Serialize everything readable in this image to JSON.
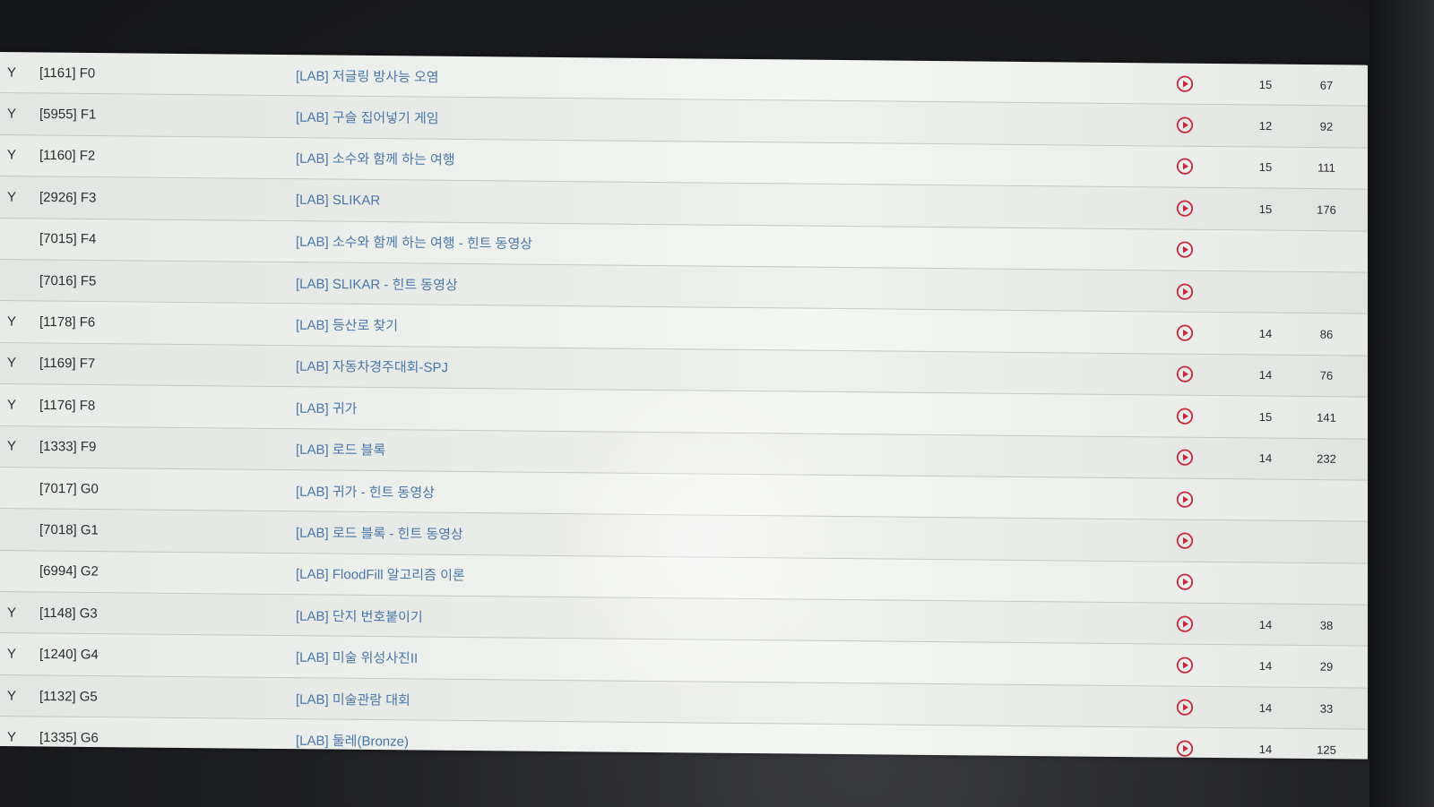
{
  "colors": {
    "link": "#4a76a8",
    "play_icon": "#c8283a",
    "text": "#2a2c2e",
    "background": "#eef0ed"
  },
  "rows": [
    {
      "flag": "Y",
      "code": "[1161] F0",
      "title": "[LAB] 저글링 방사능 오염",
      "n1": "15",
      "n2": "67",
      "icon": "play-circle-icon"
    },
    {
      "flag": "Y",
      "code": "[5955] F1",
      "title": "[LAB] 구슬 집어넣기 게임",
      "n1": "12",
      "n2": "92",
      "icon": "play-circle-icon"
    },
    {
      "flag": "Y",
      "code": "[1160] F2",
      "title": "[LAB] 소수와 함께 하는 여행",
      "n1": "15",
      "n2": "111",
      "icon": "play-circle-icon"
    },
    {
      "flag": "Y",
      "code": "[2926] F3",
      "title": "[LAB] SLIKAR",
      "n1": "15",
      "n2": "176",
      "icon": "play-circle-icon"
    },
    {
      "flag": "",
      "code": "[7015] F4",
      "title": "[LAB] 소수와 함께 하는 여행 - 힌트 동영상",
      "n1": "",
      "n2": "",
      "icon": "play-circle-icon"
    },
    {
      "flag": "",
      "code": "[7016] F5",
      "title": "[LAB] SLIKAR - 힌트 동영상",
      "n1": "",
      "n2": "",
      "icon": "play-circle-icon"
    },
    {
      "flag": "Y",
      "code": "[1178] F6",
      "title": "[LAB] 등산로 찾기",
      "n1": "14",
      "n2": "86",
      "icon": "play-circle-icon"
    },
    {
      "flag": "Y",
      "code": "[1169] F7",
      "title": "[LAB] 자동차경주대회-SPJ",
      "n1": "14",
      "n2": "76",
      "icon": "play-circle-icon"
    },
    {
      "flag": "Y",
      "code": "[1176] F8",
      "title": "[LAB] 귀가",
      "n1": "15",
      "n2": "141",
      "icon": "play-circle-icon"
    },
    {
      "flag": "Y",
      "code": "[1333] F9",
      "title": "[LAB] 로드 블록",
      "n1": "14",
      "n2": "232",
      "icon": "play-circle-icon"
    },
    {
      "flag": "",
      "code": "[7017] G0",
      "title": "[LAB] 귀가 - 힌트 동영상",
      "n1": "",
      "n2": "",
      "icon": "play-circle-icon"
    },
    {
      "flag": "",
      "code": "[7018] G1",
      "title": "[LAB] 로드 블록 - 힌트 동영상",
      "n1": "",
      "n2": "",
      "icon": "play-circle-icon"
    },
    {
      "flag": "",
      "code": "[6994] G2",
      "title": "[LAB] FloodFill 알고리즘 이론",
      "n1": "",
      "n2": "",
      "icon": "play-circle-icon"
    },
    {
      "flag": "Y",
      "code": "[1148] G3",
      "title": "[LAB] 단지 번호붙이기",
      "n1": "14",
      "n2": "38",
      "icon": "play-circle-icon"
    },
    {
      "flag": "Y",
      "code": "[1240] G4",
      "title": "[LAB] 미술 위성사진II",
      "n1": "14",
      "n2": "29",
      "icon": "play-circle-icon"
    },
    {
      "flag": "Y",
      "code": "[1132] G5",
      "title": "[LAB] 미술관람 대회",
      "n1": "14",
      "n2": "33",
      "icon": "play-circle-icon"
    },
    {
      "flag": "Y",
      "code": "[1335] G6",
      "title": "[LAB] 둘레(Bronze)",
      "n1": "14",
      "n2": "125",
      "icon": "play-circle-icon"
    }
  ]
}
